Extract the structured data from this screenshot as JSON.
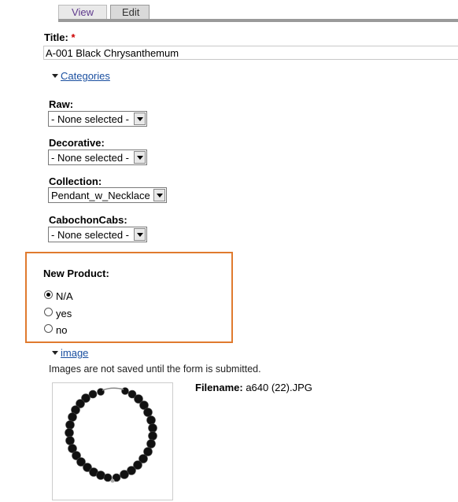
{
  "tabs": [
    {
      "label": "View"
    },
    {
      "label": "Edit"
    }
  ],
  "title_field": {
    "label": "Title:",
    "required_marker": "*",
    "value": "A-001 Black Chrysanthemum"
  },
  "categories": {
    "legend": "Categories",
    "fields": [
      {
        "label": "Raw:",
        "selected": "- None selected -"
      },
      {
        "label": "Decorative:",
        "selected": "- None selected -"
      },
      {
        "label": "Collection:",
        "selected": "Pendant_w_Necklace"
      },
      {
        "label": "CabochonCabs:",
        "selected": "- None selected -"
      }
    ]
  },
  "new_product": {
    "label": "New Product:",
    "options": [
      {
        "label": "N/A",
        "checked": true
      },
      {
        "label": "yes",
        "checked": false
      },
      {
        "label": "no",
        "checked": false
      }
    ]
  },
  "image_section": {
    "legend": "image",
    "note": "Images are not saved until the form is submitted.",
    "filename_label": "Filename:",
    "filename": "a640 (22).JPG"
  },
  "colors": {
    "highlight_border": "#e07a2e",
    "link": "#1a4fa0"
  }
}
